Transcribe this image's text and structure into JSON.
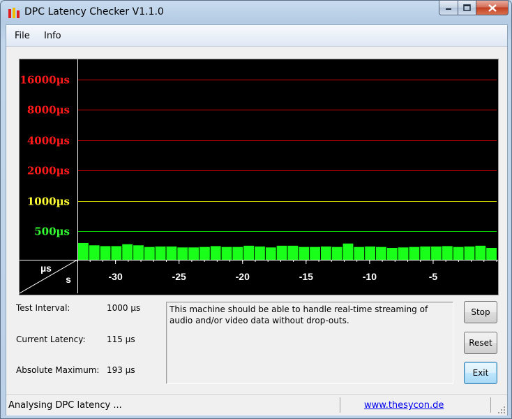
{
  "window": {
    "title": "DPC Latency Checker V1.1.0"
  },
  "menu": {
    "file": "File",
    "info": "Info"
  },
  "chart_data": {
    "type": "bar",
    "y_scale": "log2",
    "y_ticks": [
      {
        "label": "16000µs",
        "value": 16000,
        "color": "#ff1a1a"
      },
      {
        "label": "8000µs",
        "value": 8000,
        "color": "#ff1a1a"
      },
      {
        "label": "4000µs",
        "value": 4000,
        "color": "#ff1a1a"
      },
      {
        "label": "2000µs",
        "value": 2000,
        "color": "#ff1a1a"
      },
      {
        "label": "1000µs",
        "value": 1000,
        "color": "#ffff33"
      },
      {
        "label": "500µs",
        "value": 500,
        "color": "#33ff33"
      }
    ],
    "x_ticks": [
      "-30",
      "-25",
      "-20",
      "-15",
      "-10",
      "-5"
    ],
    "x_tick_values": [
      -30,
      -25,
      -20,
      -15,
      -10,
      -5
    ],
    "x_range": [
      -33,
      0
    ],
    "ylabel": "µs",
    "xlabel": "s",
    "bar_color": "#1aff1a",
    "values": [
      193,
      160,
      150,
      150,
      175,
      160,
      140,
      145,
      145,
      135,
      135,
      140,
      150,
      140,
      140,
      155,
      145,
      135,
      155,
      155,
      140,
      140,
      145,
      140,
      185,
      140,
      145,
      140,
      130,
      135,
      140,
      145,
      145,
      150,
      140,
      145,
      155,
      130
    ]
  },
  "info": {
    "test_interval_label": "Test Interval:",
    "test_interval_value": "1000 µs",
    "current_latency_label": "Current Latency:",
    "current_latency_value": "115 µs",
    "absolute_maximum_label": "Absolute Maximum:",
    "absolute_maximum_value": "193 µs"
  },
  "message": "This machine should be able to handle real-time streaming of audio and/or video data without drop-outs.",
  "buttons": {
    "stop": "Stop",
    "reset": "Reset",
    "exit": "Exit"
  },
  "status": {
    "text": "Analysing DPC latency ...",
    "link": "www.thesycon.de"
  },
  "colors": {
    "graph_background": "#000000",
    "red_line": "#cc0000",
    "yellow_line": "#cccc00",
    "green_line": "#00cc00"
  }
}
